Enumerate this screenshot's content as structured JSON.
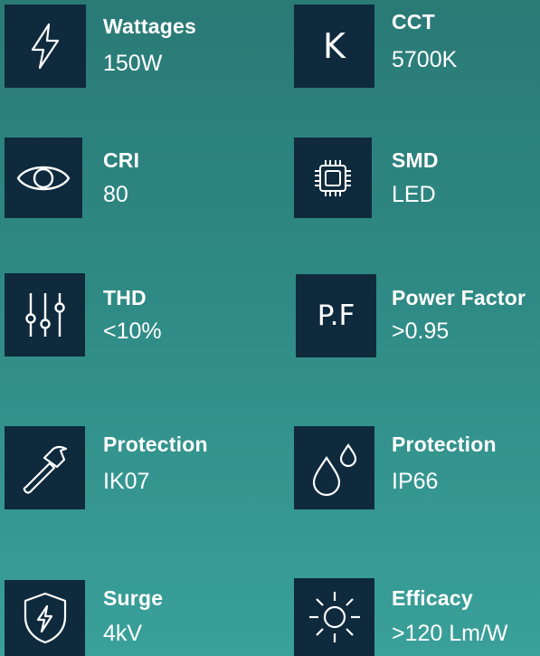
{
  "specs": [
    {
      "label": "Wattages",
      "value": "150W",
      "icon": "lightning-bolt-icon"
    },
    {
      "label": "CCT",
      "value": "5700K",
      "icon": "kelvin-letter-icon",
      "glyph": "K"
    },
    {
      "label": "CRI",
      "value": "80",
      "icon": "eye-icon"
    },
    {
      "label": "SMD",
      "value": "LED",
      "icon": "chip-icon"
    },
    {
      "label": "THD",
      "value": "<10%",
      "icon": "sliders-icon"
    },
    {
      "label": "Power Factor",
      "value": ">0.95",
      "icon": "pf-letters-icon",
      "glyph": "P.F"
    },
    {
      "label": "Protection",
      "value": "IK07",
      "icon": "hammer-icon"
    },
    {
      "label": "Protection",
      "value": "IP66",
      "icon": "water-drops-icon"
    },
    {
      "label": "Surge",
      "value": "4kV",
      "icon": "shield-bolt-icon"
    },
    {
      "label": "Efficacy",
      "value": ">120 Lm/W",
      "icon": "sun-icon"
    }
  ],
  "colors": {
    "icon_bg": "#0f2a3d",
    "text": "#ffffff",
    "bg_top": "#2a7a76",
    "bg_bottom": "#3aa09a"
  }
}
